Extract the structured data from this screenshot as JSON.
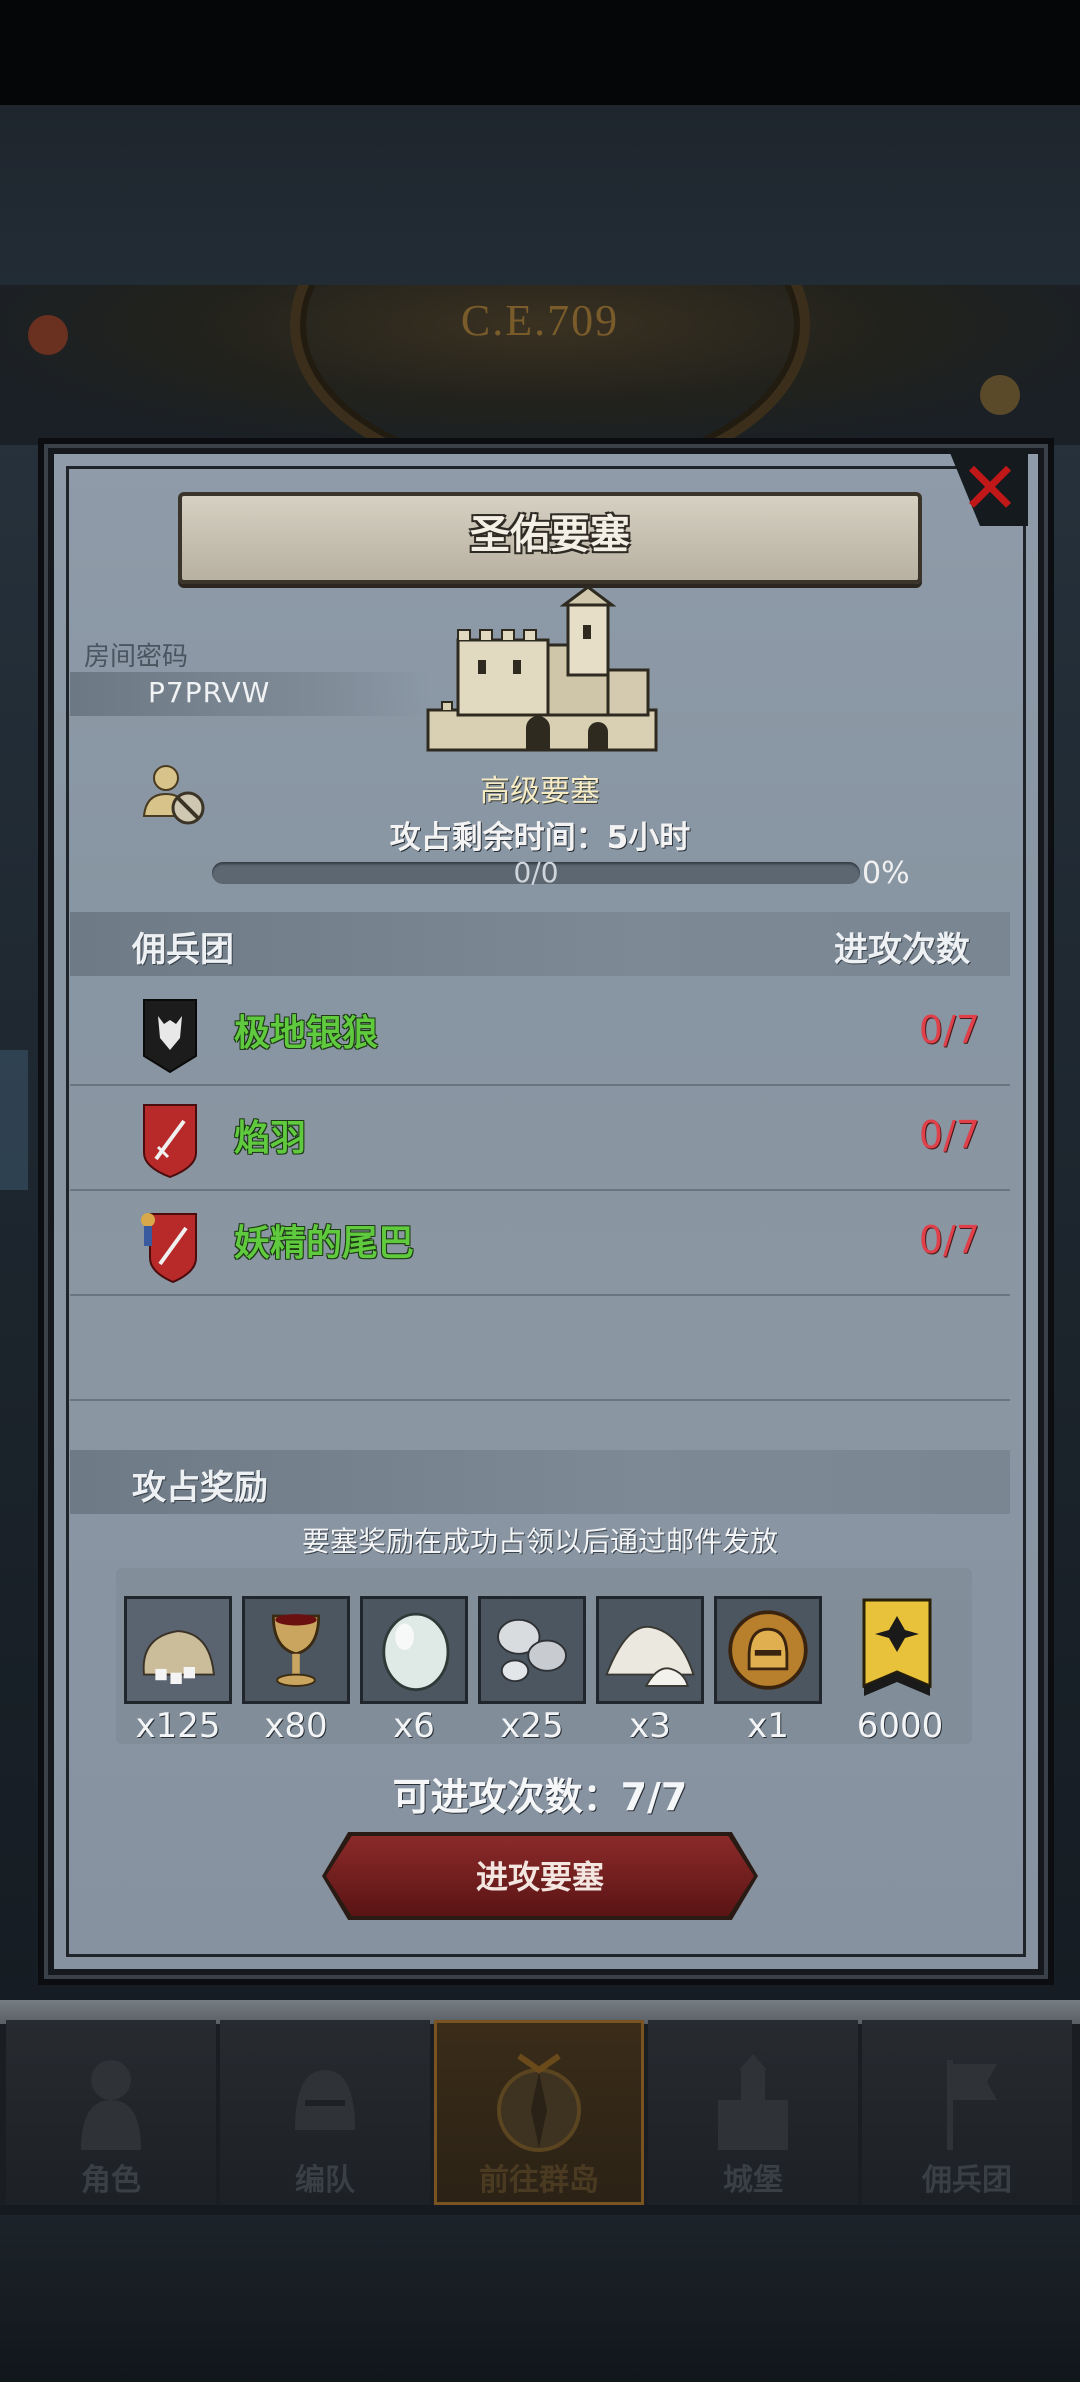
{
  "world": {
    "year": "C.E.709"
  },
  "panel": {
    "title": "圣佑要塞",
    "room_label": "房间密码",
    "room_code": "P7PRVW",
    "fort_type": "高级要塞",
    "time_remaining": "攻占剩余时间：5小时",
    "progress": {
      "text": "0/0",
      "percent_label": "0%",
      "value": 0
    }
  },
  "mercenary_section": {
    "header_left": "佣兵团",
    "header_right": "进攻次数",
    "rows": [
      {
        "name": "极地银狼",
        "count": "0/7",
        "banner_color": "#1c1c1c",
        "icon": "wolf-banner-icon"
      },
      {
        "name": "焰羽",
        "count": "0/7",
        "banner_color": "#b82a2a",
        "icon": "sword-shield-icon"
      },
      {
        "name": "妖精的尾巴",
        "count": "0/7",
        "banner_color": "#b82a2a",
        "icon": "sword-shield-icon"
      }
    ]
  },
  "reward_section": {
    "header": "攻占奖励",
    "note": "要塞奖励在成功占领以后通过邮件发放",
    "items": [
      {
        "icon": "sugar-sack-icon",
        "count": "x125"
      },
      {
        "icon": "goblet-icon",
        "count": "x80"
      },
      {
        "icon": "gem-stone-icon",
        "count": "x6"
      },
      {
        "icon": "silver-ore-icon",
        "count": "x25"
      },
      {
        "icon": "salt-pile-icon",
        "count": "x3"
      },
      {
        "icon": "golden-helmet-icon",
        "count": "x1"
      },
      {
        "icon": "guild-banner-icon",
        "count": "6000"
      }
    ]
  },
  "attempts": "可进攻次数：7/7",
  "attack_button": "进攻要塞",
  "nav": [
    {
      "label": "角色",
      "icon": "knight-icon"
    },
    {
      "label": "编队",
      "icon": "helmet-icon"
    },
    {
      "label": "前往群岛",
      "icon": "compass-icon",
      "active": true
    },
    {
      "label": "城堡",
      "icon": "castle-icon"
    },
    {
      "label": "佣兵团",
      "icon": "flag-icon"
    }
  ]
}
